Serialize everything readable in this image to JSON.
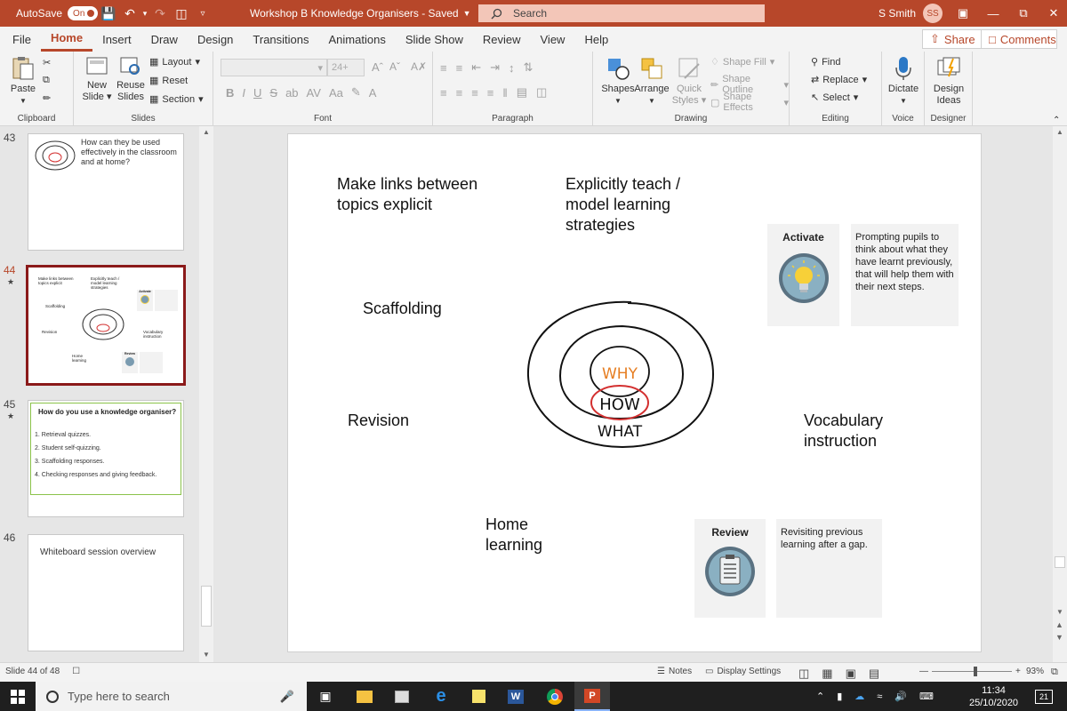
{
  "titlebar": {
    "autosave_label": "AutoSave",
    "autosave_state": "On",
    "doc_title": "Workshop B Knowledge Organisers  -  Saved",
    "search_placeholder": "Search",
    "user_name": "S Smith",
    "user_initials": "SS"
  },
  "menu": {
    "tabs": [
      "File",
      "Home",
      "Insert",
      "Draw",
      "Design",
      "Transitions",
      "Animations",
      "Slide Show",
      "Review",
      "View",
      "Help"
    ],
    "active": "Home",
    "share_label": "Share",
    "comments_label": "Comments"
  },
  "ribbon": {
    "clipboard": {
      "label": "Clipboard",
      "paste": "Paste"
    },
    "slides": {
      "label": "Slides",
      "new_slide": "New",
      "new_slide2": "Slide",
      "reuse": "Reuse",
      "reuse2": "Slides",
      "layout": "Layout",
      "reset": "Reset",
      "section": "Section"
    },
    "font": {
      "label": "Font",
      "size": "24+"
    },
    "paragraph": {
      "label": "Paragraph"
    },
    "drawing": {
      "label": "Drawing",
      "shapes": "Shapes",
      "arrange": "Arrange",
      "quick_styles": "Quick",
      "quick_styles2": "Styles",
      "shape_fill": "Shape Fill",
      "shape_outline": "Shape Outline",
      "shape_effects": "Shape Effects"
    },
    "editing": {
      "label": "Editing",
      "find": "Find",
      "replace": "Replace",
      "select": "Select"
    },
    "voice": {
      "label": "Voice",
      "dictate": "Dictate"
    },
    "designer": {
      "label": "Designer",
      "design_ideas": "Design",
      "design_ideas2": "Ideas"
    }
  },
  "thumbnails": [
    {
      "num": "43",
      "text": "How can they be used effectively in the classroom and at home?"
    },
    {
      "num": "44",
      "star": "★",
      "t1": "Make links between topics explicit",
      "t2": "Explicitly teach / model learning strategies",
      "t3": "Scaffolding",
      "t4": "Revision",
      "t5": "Vocabulary instruction",
      "t6": "Home learning",
      "t7": "Activate",
      "t8": "Review"
    },
    {
      "num": "45",
      "star": "★",
      "title": "How do you use a knowledge organiser?",
      "items": [
        "Retrieval quizzes.",
        "Student self-quizzing.",
        "Scaffolding responses.",
        "Checking responses and giving feedback."
      ]
    },
    {
      "num": "46",
      "text": "Whiteboard session overview"
    }
  ],
  "slide": {
    "links": "Make links between topics explicit",
    "links_l1": "Make links between",
    "links_l2": "topics explicit",
    "teach_l1": "Explicitly teach /",
    "teach_l2": "model  learning",
    "teach_l3": "strategies",
    "scaffolding": "Scaffolding",
    "revision": "Revision",
    "vocab_l1": "Vocabulary",
    "vocab_l2": "instruction",
    "home_l1": "Home",
    "home_l2": "learning",
    "why": "WHY",
    "how": "HOW",
    "what": "WHAT",
    "activate_title": "Activate",
    "activate_desc": "Prompting pupils to think about what they have learnt previously, that will help them with their next steps.",
    "review_title": "Review",
    "review_desc": "Revisiting previous learning after a gap."
  },
  "status": {
    "slide_of": "Slide 44 of 48",
    "notes": "Notes",
    "display_settings": "Display Settings",
    "zoom": "93%"
  },
  "taskbar": {
    "search_placeholder": "Type here to search",
    "time": "11:34",
    "date": "25/10/2020",
    "notif_count": "21"
  },
  "colors": {
    "accent": "#b7472a",
    "why": "#e67e22",
    "how_circle": "#d32f2f"
  }
}
